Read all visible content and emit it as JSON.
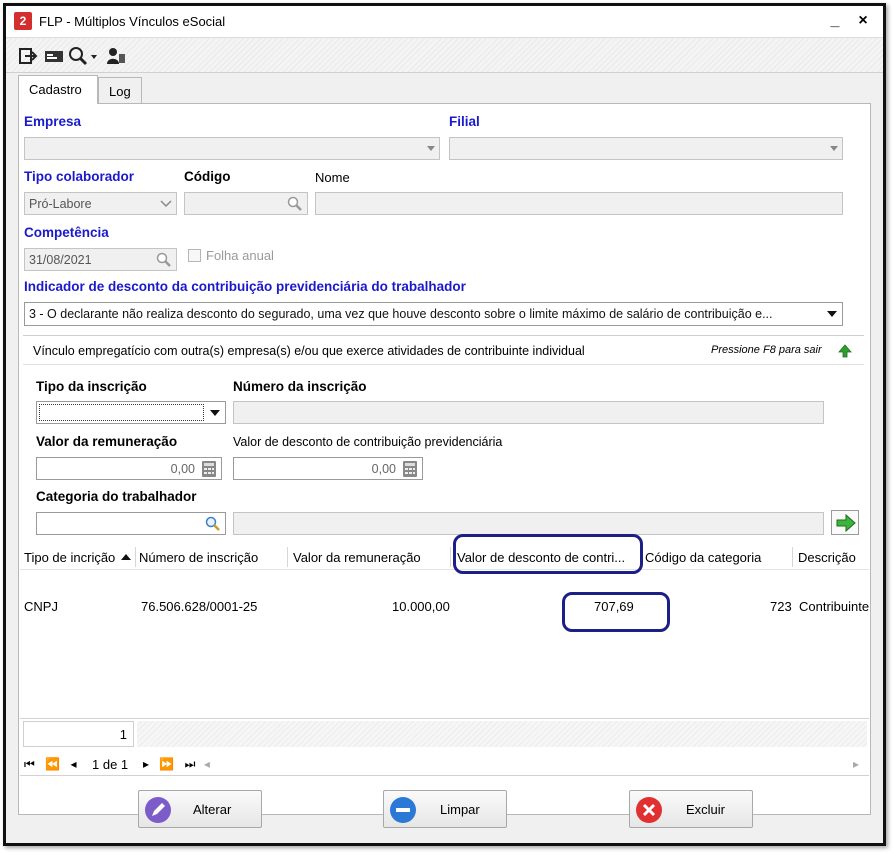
{
  "window": {
    "title": "FLP - Múltiplos Vínculos eSocial",
    "minimize_label": "_",
    "close_label": "×"
  },
  "toolbar": {
    "icons": [
      "exit-icon",
      "card-icon",
      "search-icon",
      "user-icon"
    ]
  },
  "tabs": [
    {
      "label": "Cadastro",
      "active": true
    },
    {
      "label": "Log",
      "active": false
    }
  ],
  "form": {
    "empresa_label": "Empresa",
    "filial_label": "Filial",
    "tipo_colaborador_label": "Tipo colaborador",
    "tipo_colaborador_value": "Pró-Labore",
    "codigo_label": "Código",
    "nome_label": "Nome",
    "competencia_label": "Competência",
    "competencia_value": "31/08/2021",
    "folha_anual_label": "Folha anual",
    "indicador_label": "Indicador de desconto da contribuição previdenciária do trabalhador",
    "indicador_value": "3 - O declarante não realiza desconto do segurado, uma vez que houve desconto sobre o limite máximo de salário de contribuição e..."
  },
  "vinculo": {
    "header": "Vínculo empregatício com outra(s) empresa(s) e/ou que exerce atividades de contribuinte individual",
    "hint": "Pressione F8 para sair",
    "tipo_inscricao_label": "Tipo da inscrição",
    "numero_inscricao_label": "Número da inscrição",
    "valor_remuneracao_label": "Valor da remuneração",
    "valor_remuneracao_value": "0,00",
    "valor_desconto_label": "Valor de desconto de contribuição previdenciária",
    "valor_desconto_value": "0,00",
    "categoria_label": "Categoria do trabalhador"
  },
  "grid": {
    "columns": [
      "Tipo de incrição",
      "Número de inscrição",
      "Valor da remuneração",
      "Valor de desconto de contri...",
      "Código da categoria",
      "Descrição"
    ],
    "rows": [
      {
        "tipo": "CNPJ",
        "numero": "76.506.628/0001-25",
        "remuneracao": "10.000,00",
        "desconto": "707,69",
        "codigo": "723",
        "descricao": "Contribuinte"
      }
    ],
    "count": "1",
    "page_indicator": "1 de 1"
  },
  "buttons": {
    "alterar": "Alterar",
    "limpar": "Limpar",
    "excluir": "Excluir"
  },
  "colors": {
    "label_blue": "#1a1acc",
    "highlight": "#1c1f85",
    "excluir_red": "#e03030",
    "limpar_blue": "#2b78d6",
    "alterar_purple": "#7b5cc8"
  }
}
